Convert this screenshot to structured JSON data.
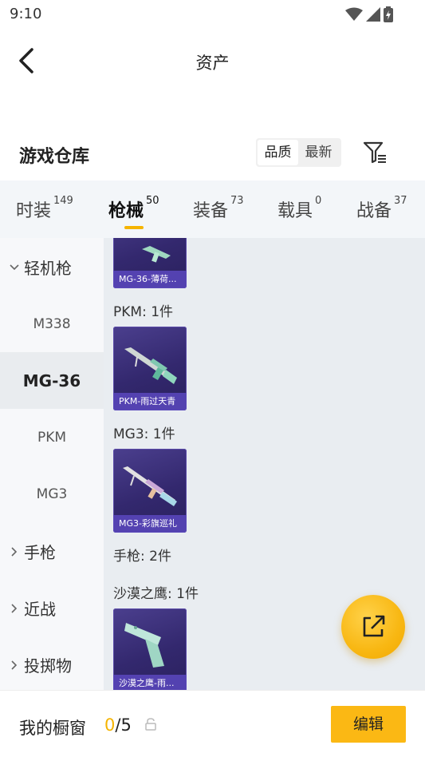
{
  "status_bar": {
    "time": "9:10"
  },
  "nav": {
    "title": "资产"
  },
  "header": {
    "title": "游戏仓库",
    "sort_options": [
      "品质",
      "最新"
    ]
  },
  "tabs": [
    {
      "label": "时装",
      "count": "149"
    },
    {
      "label": "枪械",
      "count": "50"
    },
    {
      "label": "装备",
      "count": "73"
    },
    {
      "label": "载具",
      "count": "0"
    },
    {
      "label": "战备",
      "count": "37"
    }
  ],
  "sidebar": {
    "groups": [
      "轻机枪",
      "手枪",
      "近战",
      "投掷物"
    ],
    "sub_items": [
      "M338",
      "MG-36",
      "PKM",
      "MG3"
    ]
  },
  "content": {
    "sections": [
      {
        "label": "PKM: 1件"
      },
      {
        "label": "MG3: 1件"
      },
      {
        "label": "手枪: 2件"
      },
      {
        "label": "沙漠之鹰: 1件"
      }
    ],
    "cards": [
      {
        "name": "MG-36-薄荷..."
      },
      {
        "name": "PKM-雨过天青"
      },
      {
        "name": "MG3-彩旗巡礼"
      },
      {
        "name": "沙漠之鹰-雨..."
      }
    ]
  },
  "bottom": {
    "label": "我的橱窗",
    "current": "0",
    "separator_total": "/5",
    "edit_label": "编辑"
  },
  "colors": {
    "accent": "#f5b400",
    "card_bg": "#33286e"
  },
  "icons": [
    "back-arrow-icon",
    "filter-icon",
    "chevron-down-icon",
    "chevron-right-icon",
    "share-icon",
    "lock-icon",
    "wifi-icon",
    "signal-icon",
    "battery-icon"
  ]
}
